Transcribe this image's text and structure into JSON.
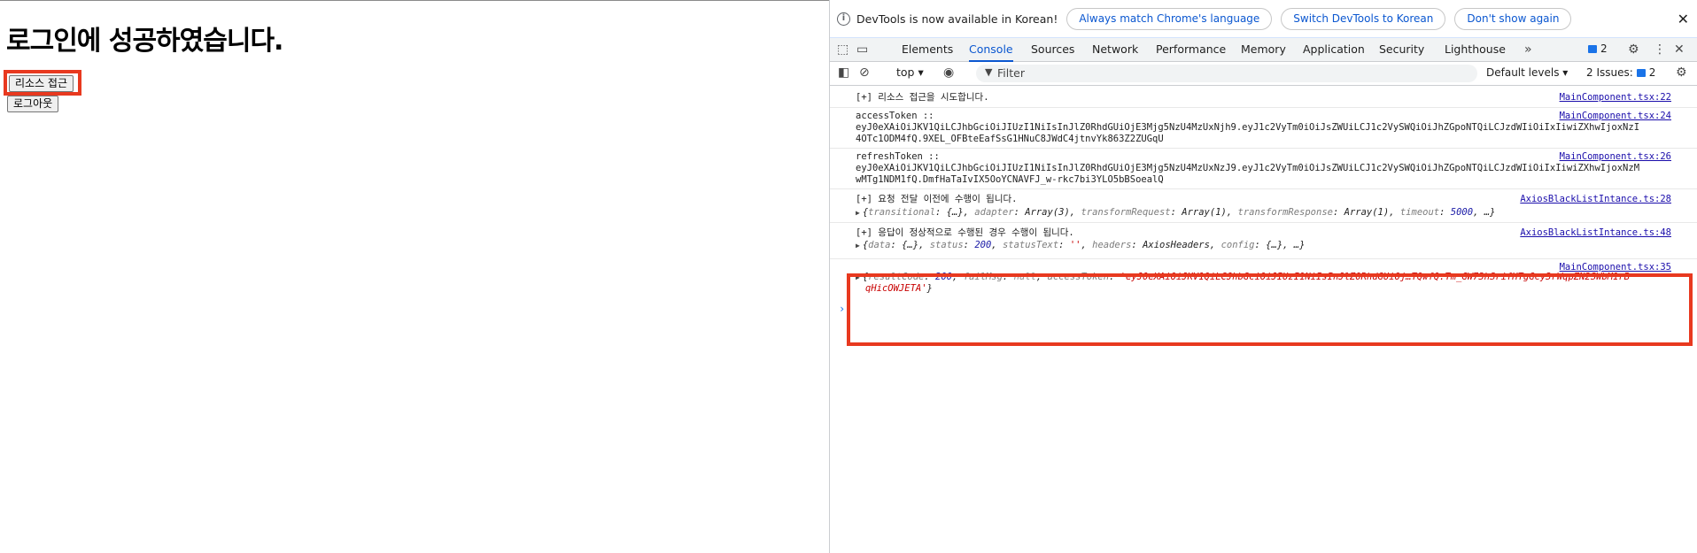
{
  "page": {
    "title": "로그인에 성공하였습니다.",
    "resource_button": "리소스 접근",
    "logout_button": "로그아웃"
  },
  "devtools": {
    "infobar": {
      "text": "DevTools is now available in Korean!",
      "btn_match": "Always match Chrome's language",
      "btn_switch": "Switch DevTools to Korean",
      "btn_dont_show": "Don't show again"
    },
    "tabs": [
      "Elements",
      "Console",
      "Sources",
      "Network",
      "Performance",
      "Memory",
      "Application",
      "Security",
      "Lighthouse"
    ],
    "active_tab": "Console",
    "issues_count": "2",
    "toolbar": {
      "context": "top",
      "filter_placeholder": "Filter",
      "levels": "Default levels",
      "issues_label": "2 Issues:",
      "issues_count": "2"
    },
    "console": [
      {
        "text": "[+] 리소스 접근을 시도합니다.",
        "source": "MainComponent.tsx:22"
      },
      {
        "text": "accessToken ::\neyJ0eXAiOiJKV1QiLCJhbGciOiJIUzI1NiIsInJlZ0RhdGUiOjE3Mjg5NzU4MzUxNjh9.eyJ1c2VyTm0iOiJsZWUiLCJ1c2VySWQiOiJhZGpoNTQiLCJzdWIiOiIxIiwiZXhwIjoxNzI\n4OTc1ODM4fQ.9XEL_OFBteEafSsG1HNuC8JWdC4jtnvYk863Z2ZUGqU",
        "source": "MainComponent.tsx:24"
      },
      {
        "text": "refreshToken ::\neyJ0eXAiOiJKV1QiLCJhbGciOiJIUzI1NiIsInJlZ0RhdGUiOjE3Mjg5NzU4MzUxNzJ9.eyJ1c2VyTm0iOiJsZWUiLCJ1c2VySWQiOiJhZGpoNTQiLCJzdWIiOiIxIiwiZXhwIjoxNzM\nwMTg1NDM1fQ.DmfHaTaIvIX5OoYCNAVFJ_w-rkc7bi3YLO5bBSoealQ",
        "source": "MainComponent.tsx:26"
      },
      {
        "text": "[+] 요청 전달 이전에 수행이 됩니다.",
        "source": "AxiosBlackListIntance.ts:28"
      },
      {
        "text": "[+] 응답이 정상적으로 수행된 경우 수행이 됩니다.",
        "source": "AxiosBlackListIntance.ts:48"
      },
      {
        "text": "",
        "source": "MainComponent.tsx:35"
      }
    ],
    "request_obj": {
      "transitional": "transitional",
      "transitional_v": "{…}",
      "adapter": "adapter",
      "adapter_v": "Array(3)",
      "transformRequest": "transformRequest",
      "transformRequest_v": "Array(1)",
      "transformResponse": "transformResponse",
      "transformResponse_v": "Array(1)",
      "timeout": "timeout",
      "timeout_v": "5000"
    },
    "response_obj": {
      "data": "data",
      "data_v": "{…}",
      "status": "status",
      "status_v": "200",
      "statusText": "statusText",
      "statusText_v": "''",
      "headers": "headers",
      "headers_v": "AxiosHeaders",
      "config": "config",
      "config_v": "{…}"
    },
    "result_obj": {
      "resultCode": "resultCode",
      "resultCode_v": "200",
      "failMsg": "failMsg",
      "failMsg_v": "null",
      "accessToken": "accessToken",
      "accessToken_v1": "'eyJ0eXAiOiJKV1QiLCJhbGciOiJIUzI1NiIsInJlZ0RhdGUiOj…TQwfQ.Tm_GW73hSrifHTgGcy3rWqpZN2SWbM1rB",
      "accessToken_v2": "qHicOWJETA'"
    },
    "colors": {
      "accent": "#0b57d0",
      "highlight": "#e8391f",
      "link": "#1a0dab"
    }
  }
}
